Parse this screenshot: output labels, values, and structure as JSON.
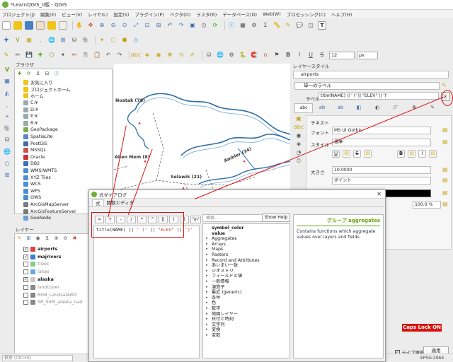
{
  "window": {
    "title": "*LearnQGIS_II版 - QGIS"
  },
  "menu": [
    "プロジェクト(J)",
    "編集(E)",
    "ビュー(V)",
    "レイヤ(L)",
    "設定(S)",
    "プラグイン(P)",
    "ベクタ(O)",
    "ラスタ(R)",
    "データベース(D)",
    "Web(W)",
    "プロセッシング(C)",
    "ヘルプ(H)"
  ],
  "toolbar": {
    "font_size_value": "12",
    "font_unit": "px",
    "ui_text_icon": "T"
  },
  "browser": {
    "title": "ブラウザ",
    "items": [
      {
        "label": "お気に入り",
        "color": "#f0c419"
      },
      {
        "label": "プロジェクトホーム",
        "color": "#f0c419"
      },
      {
        "label": "ホーム",
        "color": "#f0c419"
      },
      {
        "label": "C:¥",
        "color": "#9aa"
      },
      {
        "label": "D:¥",
        "color": "#9aa"
      },
      {
        "label": "E:¥",
        "color": "#9aa"
      },
      {
        "label": "R:¥",
        "color": "#9aa"
      },
      {
        "label": "GeoPackage",
        "color": "#7fae4c"
      },
      {
        "label": "SpatiaLite",
        "color": "#5c86c9"
      },
      {
        "label": "PostGIS",
        "color": "#3b6ea5"
      },
      {
        "label": "MSSQL",
        "color": "#c9544f"
      },
      {
        "label": "Oracle",
        "color": "#c93232"
      },
      {
        "label": "DB2",
        "color": "#3e71b6"
      },
      {
        "label": "WMS/WMTS",
        "color": "#4d8ed0"
      },
      {
        "label": "XYZ Tiles",
        "color": "#4d8ed0"
      },
      {
        "label": "WCS",
        "color": "#4d8ed0"
      },
      {
        "label": "WFS",
        "color": "#4d8ed0"
      },
      {
        "label": "OWS",
        "color": "#4d8ed0"
      },
      {
        "label": "ArcGisMapServer",
        "color": "#7a7a7a"
      },
      {
        "label": "ArcGisFeatureServer",
        "color": "#7a7a7a"
      },
      {
        "label": "GeoNode",
        "color": "#6a9fd3"
      }
    ]
  },
  "layers": {
    "title": "レイヤー",
    "items": [
      {
        "label": "airports",
        "checked": true,
        "bold": true,
        "color": "#d44"
      },
      {
        "label": "majrivers",
        "checked": true,
        "bold": true,
        "color": "#3b7dd8"
      },
      {
        "label": "trees",
        "checked": false,
        "bold": false,
        "color": "#8c8"
      },
      {
        "label": "lakes",
        "checked": false,
        "bold": false,
        "color": "#6aa8e0"
      },
      {
        "label": "alaska",
        "checked": true,
        "bold": true,
        "color": "#c9c9c9"
      },
      {
        "label": "landcover",
        "checked": false,
        "bold": false,
        "color": "#888"
      },
      {
        "label": "RGB_LandsatARD",
        "checked": false,
        "bold": false,
        "color": "#888"
      },
      {
        "label": "SR_50M_alaska_nad",
        "checked": false,
        "bold": false,
        "color": "#888"
      }
    ]
  },
  "map": {
    "labels": [
      "Noatak (78)",
      "Alien Mem (8)",
      "Selawik (21)",
      "Ambler (34)"
    ]
  },
  "layer_styling": {
    "title": "レイヤースタイル",
    "layer_name": "airports",
    "renderer": "単一のラベル",
    "label_caption": "ラベル",
    "label_expression": "title(NAME)  ||  ' ('  ||  \"ELEV\"  ||  ')'",
    "tab_abc": "abc",
    "section_text": "テキスト",
    "font_label": "フォント",
    "font_value": "MS UI Gothic",
    "style_label": "スタイル",
    "style_value": "標準",
    "size_label": "大きさ",
    "size_value": "10.0000",
    "unit_value": "ポイント",
    "color_label": "色",
    "opacity_value": "100.0 %",
    "live_update": "ライブ更新",
    "apply_button": "適用"
  },
  "expr_dialog": {
    "title": "式ダイアログ",
    "tabs": [
      "式",
      "関数エディタ"
    ],
    "operators": [
      "=",
      "+",
      "-",
      "/",
      "*",
      "^",
      "||",
      "(",
      ")",
      "'\\n'"
    ],
    "expression_parts": [
      {
        "text": "title(NAME)",
        "color": "#222222"
      },
      {
        "text": " || ",
        "color": "#222222"
      },
      {
        "text": "' ('",
        "color": "#c0392b"
      },
      {
        "text": " || ",
        "color": "#222222"
      },
      {
        "text": "\"ELEV\"",
        "color": "#c0392b"
      },
      {
        "text": " || ",
        "color": "#222222"
      },
      {
        "text": "')'",
        "color": "#c0392b"
      }
    ],
    "search_placeholder": "検索...",
    "show_help": "Show Help",
    "functions": [
      {
        "label": "symbol_color",
        "bold": true,
        "arrow": false
      },
      {
        "label": "value",
        "bold": true,
        "arrow": false
      },
      {
        "label": "Aggregates",
        "bold": false,
        "arrow": true
      },
      {
        "label": "Arrays",
        "bold": false,
        "arrow": true
      },
      {
        "label": "Maps",
        "bold": false,
        "arrow": true
      },
      {
        "label": "Rasters",
        "bold": false,
        "arrow": true
      },
      {
        "label": "Record and Attributes",
        "bold": false,
        "arrow": true
      },
      {
        "label": "あいまい一致",
        "bold": false,
        "arrow": true
      },
      {
        "label": "ジオメトリ",
        "bold": false,
        "arrow": true
      },
      {
        "label": "フィールドと値",
        "bold": false,
        "arrow": true
      },
      {
        "label": "一般情報",
        "bold": false,
        "arrow": true
      },
      {
        "label": "演算子",
        "bold": false,
        "arrow": true
      },
      {
        "label": "最近 (generic)",
        "bold": false,
        "arrow": true
      },
      {
        "label": "条件",
        "bold": false,
        "arrow": true
      },
      {
        "label": "色",
        "bold": false,
        "arrow": true
      },
      {
        "label": "数学",
        "bold": false,
        "arrow": true
      },
      {
        "label": "地図レイヤー",
        "bold": false,
        "arrow": true
      },
      {
        "label": "日付と時刻",
        "bold": false,
        "arrow": true
      },
      {
        "label": "文字列",
        "bold": false,
        "arrow": true
      },
      {
        "label": "変換",
        "bold": false,
        "arrow": true
      },
      {
        "label": "変数",
        "bold": false,
        "arrow": true
      }
    ],
    "help_title": "グループ aggregates",
    "help_text": "Contains functions which aggregate values over layers and fields.",
    "help_title_color": "#6aa20f"
  },
  "statusbar": {
    "search_placeholder": "検索 (Ctrl+K)",
    "coords": "EPSG:2964"
  },
  "capslock": "Caps Lock ON",
  "accent": "#e01010"
}
